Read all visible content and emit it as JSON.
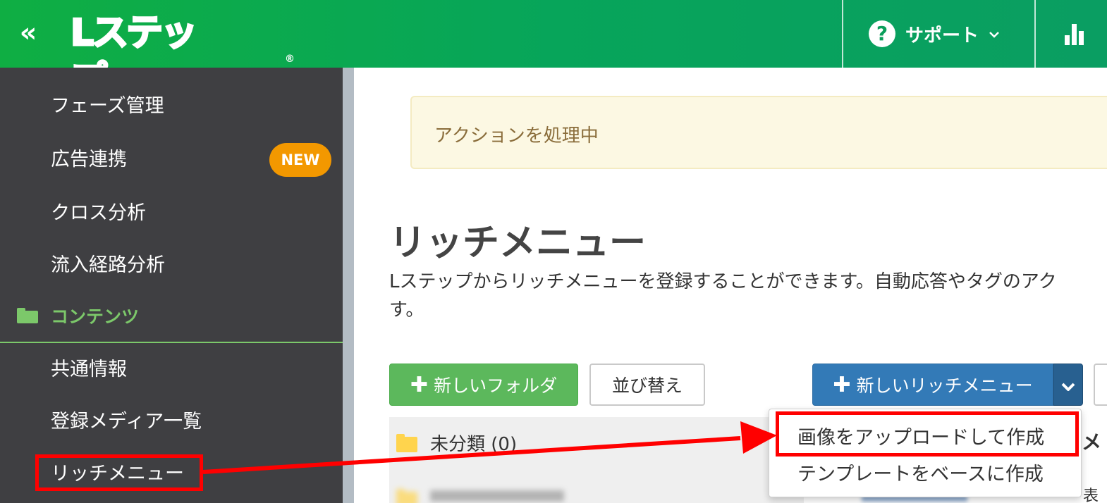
{
  "header": {
    "collapse_glyph": "«",
    "logo_text": "Lステップ",
    "logo_reg": "®",
    "support_label": "サポート",
    "support_icon": "question-circle-icon",
    "support_chevron": "⌄",
    "analytics_icon": "bar-chart-icon"
  },
  "sidebar": {
    "items": [
      {
        "label": "フェーズ管理"
      },
      {
        "label": "広告連携",
        "badge": "NEW"
      },
      {
        "label": "クロス分析"
      },
      {
        "label": "流入経路分析"
      }
    ],
    "section": {
      "label": "コンテンツ"
    },
    "section_items": [
      {
        "label": "共通情報"
      },
      {
        "label": "登録メディア一覧"
      },
      {
        "label": "リッチメニュー"
      }
    ]
  },
  "main": {
    "notice": "アクションを処理中",
    "title": "リッチメニュー",
    "description": "Lステップからリッチメニューを登録することができます。自動応答やタグのアク",
    "description_line2": "す。",
    "buttons": {
      "new_folder": "新しいフォルダ",
      "sort": "並び替え",
      "new_rich_menu": "新しいリッチメニュー",
      "plus": "✚",
      "caret": "⌄"
    },
    "folders": [
      {
        "label": "未分類 (0)"
      }
    ],
    "dropdown": {
      "items": [
        "画像をアップロードして作成",
        "テンプレートをベースに作成"
      ]
    },
    "right_col_text": "メ",
    "right_col_text2": "表"
  },
  "annotation": {
    "color": "#ff0000"
  }
}
